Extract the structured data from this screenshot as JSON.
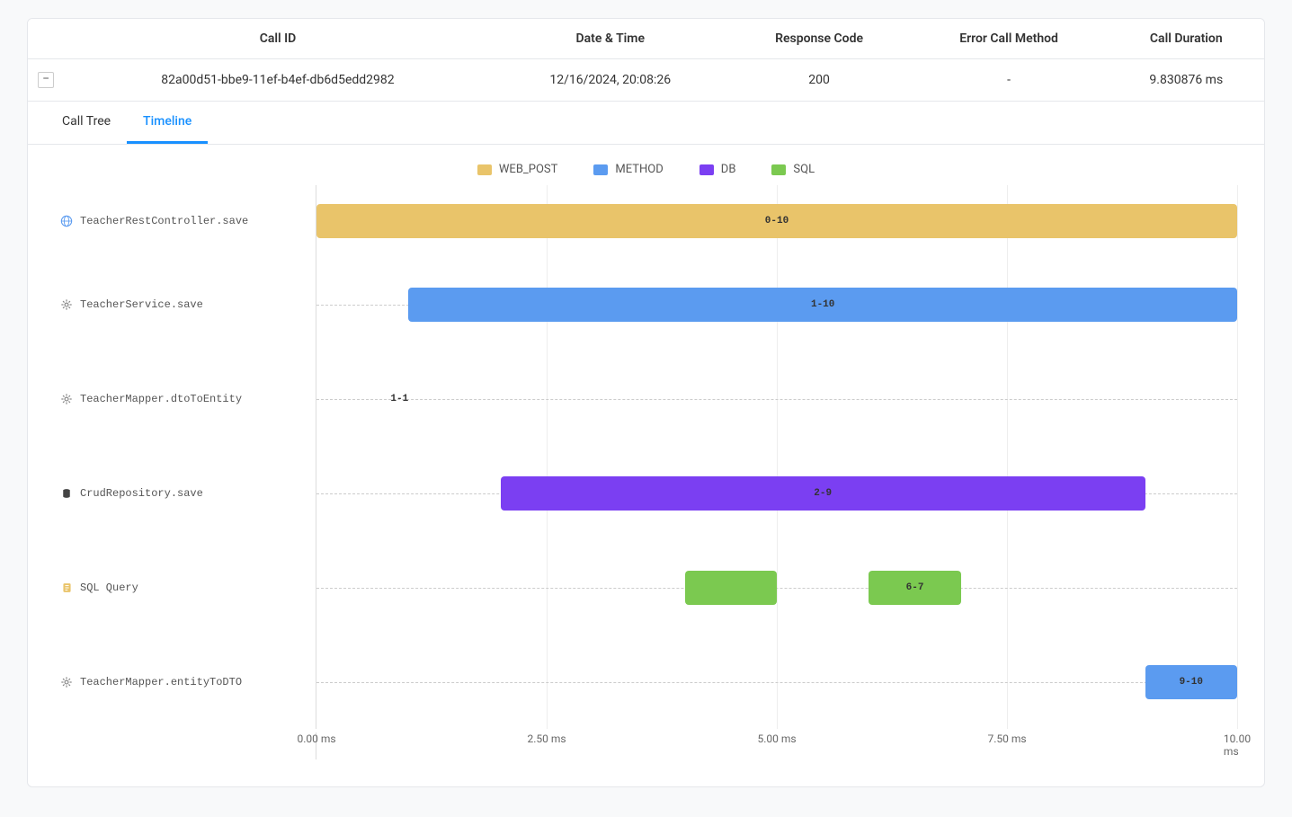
{
  "table": {
    "headers": {
      "callId": "Call ID",
      "datetime": "Date & Time",
      "responseCode": "Response Code",
      "errorMethod": "Error Call Method",
      "duration": "Call Duration"
    },
    "row": {
      "callId": "82a00d51-bbe9-11ef-b4ef-db6d5edd2982",
      "datetime": "12/16/2024, 20:08:26",
      "responseCode": "200",
      "errorMethod": "-",
      "duration": "9.830876 ms"
    }
  },
  "tabs": {
    "callTree": "Call Tree",
    "timeline": "Timeline"
  },
  "legend": {
    "webpost": "WEB_POST",
    "method": "METHOD",
    "db": "DB",
    "sql": "SQL"
  },
  "colors": {
    "webpost": "#e9c46a",
    "method": "#5b9bf0",
    "db": "#7b3ff2",
    "sql": "#7bc950"
  },
  "chart_data": {
    "type": "bar",
    "xlabel": "",
    "ylabel": "",
    "xlim": [
      0,
      10
    ],
    "ticks": [
      "0.00 ms",
      "2.50 ms",
      "5.00 ms",
      "7.50 ms",
      "10.00 ms"
    ],
    "rows": [
      {
        "name": "TeacherRestController.save",
        "icon": "globe",
        "bars": [
          {
            "start": 0,
            "end": 10,
            "type": "webpost",
            "label": "0-10"
          }
        ]
      },
      {
        "name": "TeacherService.save",
        "icon": "gear",
        "bars": [
          {
            "start": 1,
            "end": 10,
            "type": "method",
            "label": "1-10"
          }
        ]
      },
      {
        "name": "TeacherMapper.dtoToEntity",
        "icon": "gear",
        "bars": [
          {
            "start": 1,
            "end": 1,
            "type": "method",
            "label": "1-1",
            "labelOutside": true
          }
        ]
      },
      {
        "name": "CrudRepository.save",
        "icon": "db",
        "bars": [
          {
            "start": 2,
            "end": 9,
            "type": "db",
            "label": "2-9"
          }
        ]
      },
      {
        "name": "SQL Query",
        "icon": "sql",
        "bars": [
          {
            "start": 4,
            "end": 5,
            "type": "sql",
            "label": ""
          },
          {
            "start": 6,
            "end": 7,
            "type": "sql",
            "label": "6-7"
          }
        ]
      },
      {
        "name": "TeacherMapper.entityToDTO",
        "icon": "gear",
        "bars": [
          {
            "start": 9,
            "end": 10,
            "type": "method",
            "label": "9-10"
          }
        ]
      }
    ]
  }
}
